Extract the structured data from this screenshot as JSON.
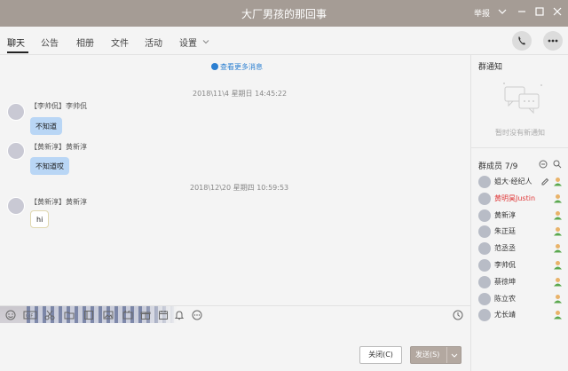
{
  "window": {
    "title": "大厂男孩的那回事",
    "report_label": "举报"
  },
  "tabs": [
    {
      "label": "聊天"
    },
    {
      "label": "公告"
    },
    {
      "label": "相册"
    },
    {
      "label": "文件"
    },
    {
      "label": "活动"
    },
    {
      "label": "设置"
    }
  ],
  "chat": {
    "more_messages": "查看更多消息",
    "timestamps": [
      "2018\\11\\4 星期日 14:45:22",
      "2018\\12\\20 星期四 10:59:53"
    ],
    "messages": [
      {
        "sender": "【李帅侃】李帅侃",
        "text": "不知道"
      },
      {
        "sender": "【黄新淳】黄新淳",
        "text": "不知道哎"
      },
      {
        "sender": "【黄新淳】黄新淳",
        "text": "hi"
      }
    ]
  },
  "composer": {
    "close_label": "关闭(C)",
    "send_label": "发送(S)"
  },
  "sidebar": {
    "notice_title": "群通知",
    "notice_empty": "暂时没有新通知",
    "members_title": "群成员 7/9",
    "members": [
      {
        "name": "姐大·经纪人"
      },
      {
        "name": "黄明昊Justin",
        "highlight": true
      },
      {
        "name": "黄新淳"
      },
      {
        "name": "朱正廷"
      },
      {
        "name": "范丞丞"
      },
      {
        "name": "李帅侃"
      },
      {
        "name": "蔡徐坤"
      },
      {
        "name": "陈立农"
      },
      {
        "name": "尤长靖"
      }
    ]
  },
  "colors": {
    "titlebar": "#a59c95",
    "link": "#2b7fd1",
    "bubble": "#b9d6f5",
    "highlight_name": "#e03a3a"
  }
}
